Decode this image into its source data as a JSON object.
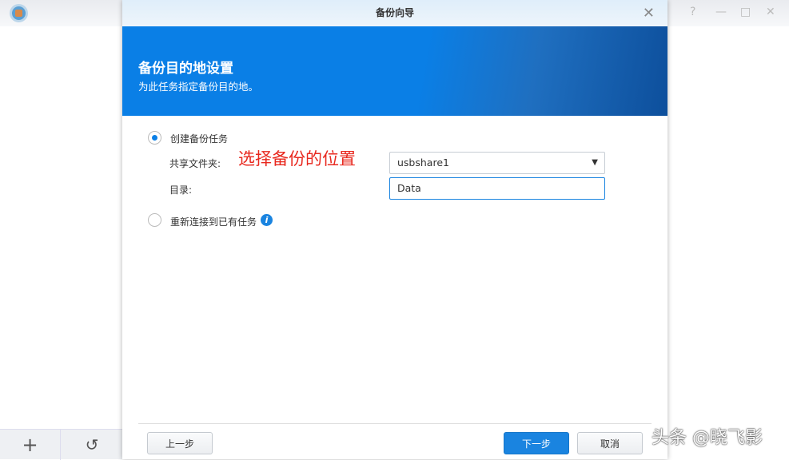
{
  "dialog": {
    "title": "备份向导",
    "heading": "备份目的地设置",
    "subheading": "为此任务指定备份目的地。"
  },
  "form": {
    "create_task": "创建备份任务",
    "shared_folder_label": "共享文件夹:",
    "shared_folder_value": "usbshare1",
    "directory_label": "目录:",
    "directory_value": "Data",
    "reconnect_task": "重新连接到已有任务"
  },
  "annotation": "选择备份的位置",
  "buttons": {
    "back": "上一步",
    "next": "下一步",
    "cancel": "取消"
  },
  "window_controls": {
    "help": "?",
    "minimize": "—",
    "maximize": "□",
    "close": "✕"
  },
  "watermark": "头条 @晓飞影"
}
